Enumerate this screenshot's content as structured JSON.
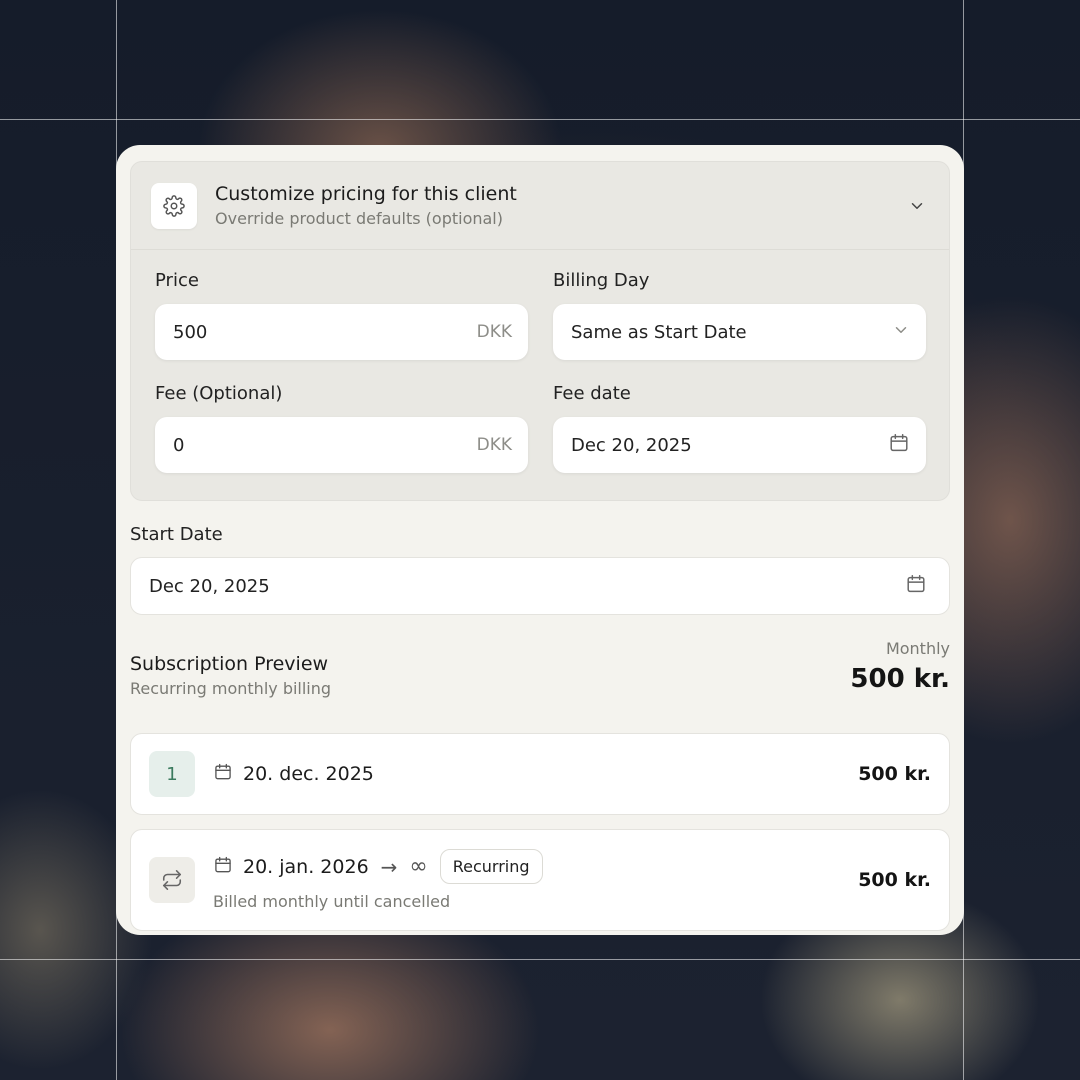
{
  "custom_pricing": {
    "title": "Customize pricing for this client",
    "subtitle": "Override product defaults (optional)"
  },
  "fields": {
    "price": {
      "label": "Price",
      "value": "500",
      "unit": "DKK"
    },
    "billing_day": {
      "label": "Billing Day",
      "value": "Same as Start Date"
    },
    "fee": {
      "label": "Fee (Optional)",
      "value": "0",
      "unit": "DKK"
    },
    "fee_date": {
      "label": "Fee date",
      "value": "Dec 20, 2025"
    }
  },
  "start_date": {
    "label": "Start Date",
    "value": "Dec 20, 2025"
  },
  "preview": {
    "title": "Subscription Preview",
    "subtitle": "Recurring monthly billing",
    "period": "Monthly",
    "total": "500 kr."
  },
  "schedule": [
    {
      "index": "1",
      "date": "20. dec. 2025",
      "amount": "500 kr."
    },
    {
      "date": "20. jan. 2026",
      "arrow": "→",
      "infinity": "∞",
      "badge": "Recurring",
      "note": "Billed monthly until cancelled",
      "amount": "500 kr."
    }
  ],
  "colors": {
    "accent_green": "#3b7a5e",
    "card_bg": "#f4f3ee"
  },
  "icons": [
    "gear-icon",
    "chevron-down-icon",
    "calendar-icon",
    "repeat-icon"
  ]
}
